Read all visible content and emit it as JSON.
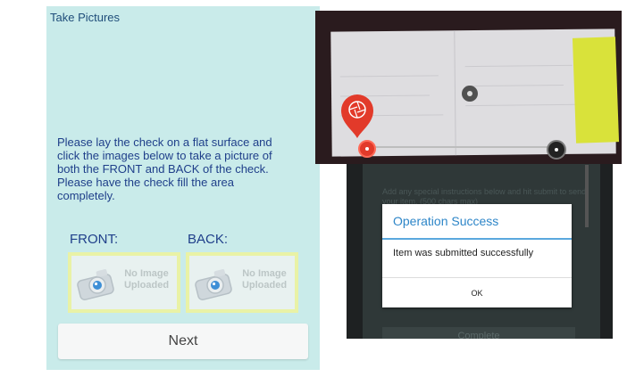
{
  "left_screen": {
    "title": "Take Pictures",
    "instructions": "Please lay the check on a flat surface and click the images below to take a picture of both the FRONT and BACK of the check. Please have the check fill the area completely.",
    "front_label": "FRONT:",
    "back_label": "BACK:",
    "front_placeholder": {
      "line1": "No Image",
      "line2": "Uploaded",
      "icon": "camera-icon"
    },
    "back_placeholder": {
      "line1": "No Image",
      "line2": "Uploaded",
      "icon": "camera-icon"
    },
    "next_label": "Next"
  },
  "camera_view": {
    "shutter_icon": "aperture-icon",
    "accent": "#e23a2a"
  },
  "dialog_screen": {
    "background_text": "Add any special instructions below and hit submit to send your item. (500 chars max)",
    "background_button": "Complete",
    "dialog": {
      "title": "Operation Success",
      "message": "Item was submitted successfully",
      "ok_label": "OK",
      "accent": "#2e86c8"
    }
  }
}
